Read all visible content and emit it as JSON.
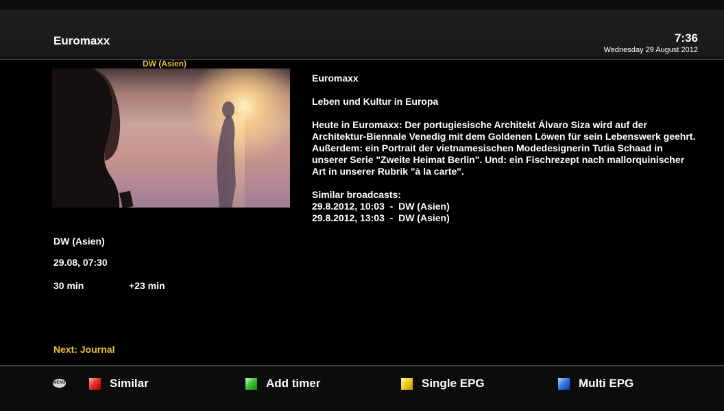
{
  "header": {
    "title": "Euromaxx",
    "time": "7:36",
    "date": "Wednesday 29 August 2012"
  },
  "preview": {
    "label": "DW (Asien)"
  },
  "event_info": {
    "channel": "DW (Asien)",
    "start": "29.08, 07:30",
    "duration": "30 min",
    "remaining": "+23 min",
    "next": "Next: Journal"
  },
  "description": {
    "title": "Euromaxx",
    "subtitle": "Leben und Kultur in Europa",
    "body": "Heute in Euromaxx: Der portugiesische Architekt Álvaro Siza wird auf der Architektur-Biennale Venedig mit dem Goldenen Löwen für sein Lebenswerk geehrt. Außerdem: ein Portrait der vietnamesischen Modedesignerin Tutia Schaad in unserer Serie \"Zweite Heimat Berlin\". Und: ein Fischrezept nach mallorquinischer Art in unserer Rubrik \"à la carte\".",
    "similar_heading": "Similar broadcasts:",
    "similar": [
      "29.8.2012, 10:03  -  DW (Asien)",
      "29.8.2012, 13:03  -  DW (Asien)"
    ]
  },
  "footer": {
    "menu_icon": "MENU",
    "buttons": [
      {
        "color": "red",
        "label": "Similar"
      },
      {
        "color": "green",
        "label": "Add timer"
      },
      {
        "color": "yellow",
        "label": "Single EPG"
      },
      {
        "color": "blue",
        "label": "Multi EPG"
      }
    ]
  }
}
